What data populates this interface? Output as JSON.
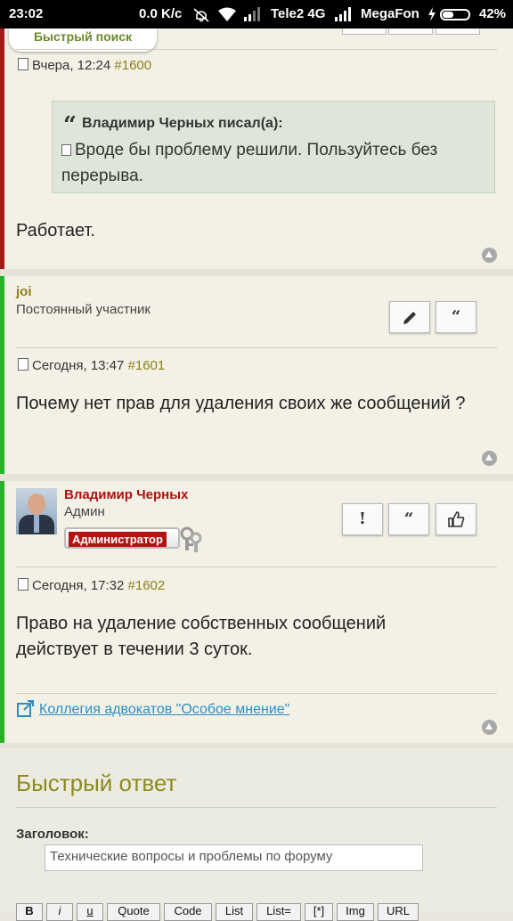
{
  "status_bar": {
    "time": "23:02",
    "speed": "0.0 K/c",
    "carrier1": "Tele2 4G",
    "carrier2": "MegaFon",
    "battery": "42%",
    "battery_level": 0.42
  },
  "quick_search": {
    "label": "Быстрый поиск"
  },
  "posts": [
    {
      "date": "Вчера, 12:24",
      "number": "#1600",
      "quote": {
        "author": "Владимир Черных писал(а):",
        "text": "Вроде бы проблему решили. Пользуйтесь без перерыва."
      },
      "text": "Работает."
    },
    {
      "author": "joi",
      "role": "Постоянный участник",
      "date": "Сегодня, 13:47",
      "number": "#1601",
      "text": "Почему нет прав для удаления своих же сообщений ?"
    },
    {
      "author": "Владимир Черных",
      "role": "Админ",
      "badge": "Администратор",
      "date": "Сегодня, 17:32",
      "number": "#1602",
      "text": "Право на удаление собственных сообщений действует в течении 3 суток.",
      "signature_link": "Коллегия адвокатов \"Особое мнение\""
    }
  ],
  "quick_reply": {
    "title": "Быстрый ответ",
    "subject_label": "Заголовок:",
    "subject_value": "Технические вопросы и проблемы по форуму"
  },
  "toolbar": [
    "B",
    "i",
    "u",
    "Quote",
    "Code",
    "List",
    "List=",
    "[*]",
    "Img",
    "URL"
  ],
  "colors": {
    "post_border_red": "#a51919",
    "post_border_green": "#23b323",
    "accent_olive": "#8d8a22",
    "link_blue": "#2a8ec4"
  }
}
